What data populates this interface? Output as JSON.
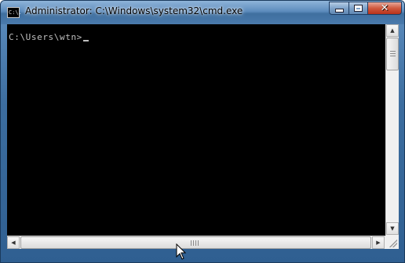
{
  "window": {
    "title": "Administrator: C:\\Windows\\system32\\cmd.exe",
    "icon": "cmd-icon",
    "icon_text": "C:\\."
  },
  "controls": {
    "minimize_icon": "minimize-icon",
    "maximize_icon": "maximize-icon",
    "close_icon": "close-icon"
  },
  "console": {
    "prompt": "C:\\Users\\wtn>",
    "background": "#000000",
    "foreground": "#c0c0c0"
  },
  "scrollbars": {
    "up_arrow": "▲",
    "down_arrow": "▼",
    "left_arrow": "◀",
    "right_arrow": "▶"
  },
  "colors": {
    "frame": "#3c6d9f",
    "close": "#c8412a"
  }
}
